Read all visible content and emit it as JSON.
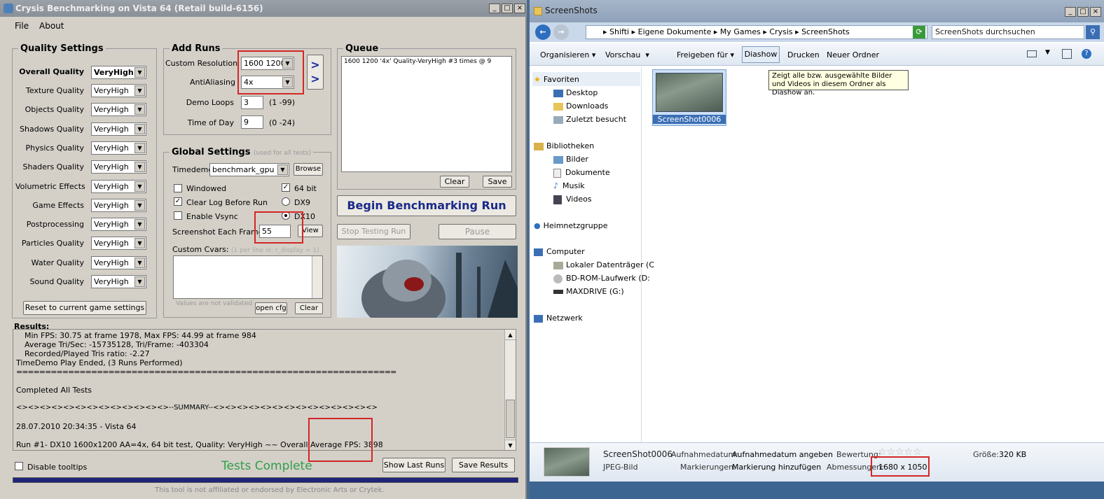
{
  "left_window": {
    "title": "Crysis Benchmarking on Vista 64 (Retail build-6156)",
    "menu": [
      "File",
      "About"
    ],
    "quality": {
      "legend": "Quality Settings",
      "overall_label": "Overall Quality",
      "overall_value": "VeryHigh",
      "items": [
        {
          "label": "Texture Quality",
          "value": "VeryHigh"
        },
        {
          "label": "Objects Quality",
          "value": "VeryHigh"
        },
        {
          "label": "Shadows Quality",
          "value": "VeryHigh"
        },
        {
          "label": "Physics Quality",
          "value": "VeryHigh"
        },
        {
          "label": "Shaders Quality",
          "value": "VeryHigh"
        },
        {
          "label": "Volumetric Effects",
          "value": "VeryHigh"
        },
        {
          "label": "Game Effects",
          "value": "VeryHigh"
        },
        {
          "label": "Postprocessing",
          "value": "VeryHigh"
        },
        {
          "label": "Particles Quality",
          "value": "VeryHigh"
        },
        {
          "label": "Water Quality",
          "value": "VeryHigh"
        },
        {
          "label": "Sound Quality",
          "value": "VeryHigh"
        }
      ],
      "reset_button": "Reset to current game settings"
    },
    "add_runs": {
      "legend": "Add Runs",
      "resolution_label": "Custom Resolution",
      "resolution_value": "1600 1200",
      "aa_label": "AntiAliasing",
      "aa_value": "4x",
      "loops_label": "Demo Loops",
      "loops_value": "3",
      "loops_hint": "(1 -99)",
      "tod_label": "Time of Day",
      "tod_value": "9",
      "tod_hint": "(0 -24)",
      "add_button": ">\n>"
    },
    "queue": {
      "legend": "Queue",
      "items": [
        "1600 1200 '4x' Quality-VeryHigh #3 times @ 9"
      ],
      "clear": "Clear",
      "save": "Save"
    },
    "global": {
      "legend": "Global Settings",
      "legend_note": "(used for all tests)",
      "timedemo_label": "Timedemo",
      "timedemo_value": "benchmark_gpu",
      "browse": "Browse",
      "windowed": "Windowed",
      "clear_log": "Clear Log Before Run",
      "vsync": "Enable Vsync",
      "bit64": "64 bit",
      "dx9": "DX9",
      "dx10": "DX10",
      "screenshot_label": "Screenshot Each Frame",
      "screenshot_value": "55",
      "view": "View",
      "cvars_label": "Custom Cvars:",
      "cvars_hint": "(1 per line ie: r_display = 1)",
      "not_validated": "Values are not validated",
      "open_cfg": "open cfg",
      "clear": "Clear"
    },
    "begin_button": "Begin Benchmarking Run",
    "stop_button": "Stop Testing Run",
    "pause_button": "Pause",
    "results": {
      "label": "Results:",
      "lines": [
        "Min FPS: 30.75 at frame 1978, Max FPS: 44.99 at frame 984",
        "Average Tri/Sec: -15735128, Tri/Frame: -403304",
        "Recorded/Played Tris ratio: -2.27",
        "TimeDemo Play Ended, (3 Runs Performed)",
        "==================================================================",
        "Completed All Tests",
        "<><><><><><><><><><><><><>--SUMMARY--<><><><><><><><><><><><><><>",
        "28.07.2010 20:34:35 - Vista 64",
        "Run #1- DX10 1600x1200 AA=4x, 64 bit test, Quality: VeryHigh ~~ Overall Average FPS: 3898"
      ]
    },
    "disable_tooltips": "Disable tooltips",
    "status": "Tests Complete",
    "show_last_runs": "Show Last Runs",
    "save_results": "Save Results",
    "disclaimer": "This tool is not affiliated or endorsed by Electronic Arts or Crytek."
  },
  "right_window": {
    "title": "ScreenShots",
    "breadcrumb": [
      "Shifti",
      "Eigene Dokumente",
      "My Games",
      "Crysis",
      "ScreenShots"
    ],
    "search_placeholder": "ScreenShots durchsuchen",
    "toolbar": [
      "Organisieren",
      "Vorschau",
      "Freigeben für",
      "Diashow",
      "Drucken",
      "Neuer Ordner"
    ],
    "tooltip": "Zeigt alle bzw. ausgewählte Bilder und Videos in diesem Ordner als Diashow an.",
    "nav": {
      "favorites": "Favoriten",
      "desktop": "Desktop",
      "downloads": "Downloads",
      "recent": "Zuletzt besucht",
      "libraries": "Bibliotheken",
      "pictures": "Bilder",
      "documents": "Dokumente",
      "music": "Musik",
      "videos": "Videos",
      "homegroup": "Heimnetzgruppe",
      "computer": "Computer",
      "local_disk": "Lokaler Datenträger (C",
      "bdrom": "BD-ROM-Laufwerk (D:",
      "maxdrive": "MAXDRIVE (G:)",
      "network": "Netzwerk"
    },
    "file_name": "ScreenShot0006",
    "details": {
      "name": "ScreenShot0006",
      "type": "JPEG-Bild",
      "date_label": "Aufnahmedatum:",
      "date_value": "Aufnahmedatum angeben",
      "tags_label": "Markierungen:",
      "tags_value": "Markierung hinzufügen",
      "rating_label": "Bewertung:",
      "stars": "☆☆☆☆☆",
      "dims_label": "Abmessungen:",
      "dims_value": "1680 x 1050",
      "size_label": "Größe:",
      "size_value": "320 KB"
    }
  }
}
